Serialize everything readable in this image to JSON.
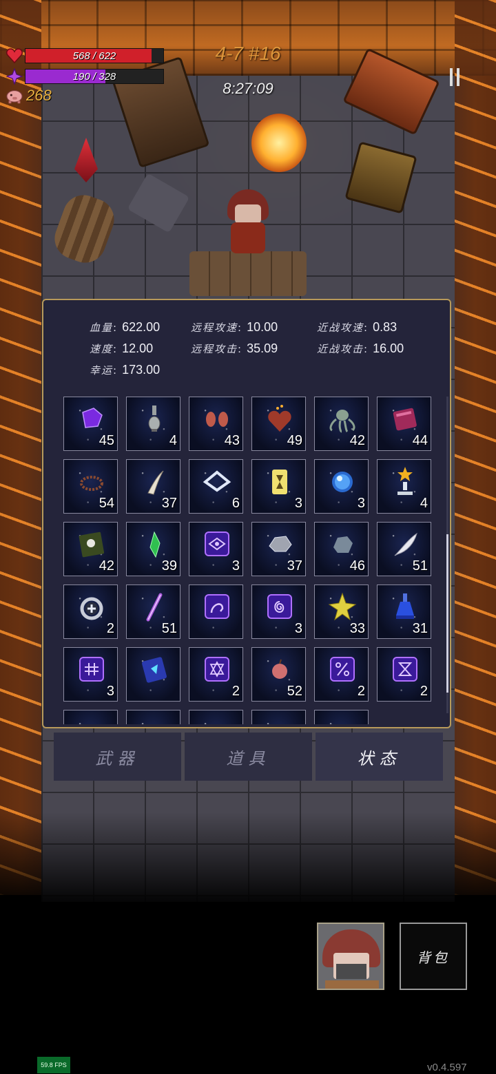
{
  "hud": {
    "hp_text": "568 / 622",
    "hp_fraction": 0.913,
    "mp_text": "190 / 328",
    "mp_fraction": 0.579,
    "gold": "268",
    "level": "4-7 #16",
    "timer": "8:27:09"
  },
  "colors": {
    "hp": "#d0202a",
    "mp": "#9a2ad0",
    "gold": "#e8b040",
    "panel_border": "#b89a5a"
  },
  "stats": {
    "hp": {
      "label": "血量",
      "value": "622.00"
    },
    "speed": {
      "label": "速度",
      "value": "12.00"
    },
    "luck": {
      "label": "幸运",
      "value": "173.00"
    },
    "ranged_speed": {
      "label": "远程攻速",
      "value": "10.00"
    },
    "ranged_attack": {
      "label": "远程攻击",
      "value": "35.09"
    },
    "melee_speed": {
      "label": "近战攻速",
      "value": "0.83"
    },
    "melee_attack": {
      "label": "近战攻击",
      "value": "16.00"
    }
  },
  "items": [
    {
      "icon": "purple-gem-icon",
      "count": "45"
    },
    {
      "icon": "potion-flask-icon",
      "count": "4"
    },
    {
      "icon": "glove-pair-icon",
      "count": "43"
    },
    {
      "icon": "fire-heart-icon",
      "count": "49"
    },
    {
      "icon": "tentacle-creature-icon",
      "count": "42"
    },
    {
      "icon": "red-book-icon",
      "count": "44"
    },
    {
      "icon": "thorn-wreath-icon",
      "count": "54"
    },
    {
      "icon": "fang-icon",
      "count": "37"
    },
    {
      "icon": "diamond-frame-icon",
      "count": "6"
    },
    {
      "icon": "hourglass-card-icon",
      "count": "3"
    },
    {
      "icon": "blue-orb-icon",
      "count": "3"
    },
    {
      "icon": "star-trophy-icon",
      "count": "4"
    },
    {
      "icon": "skull-book-icon",
      "count": "42"
    },
    {
      "icon": "green-crystal-icon",
      "count": "39"
    },
    {
      "icon": "rune-eye-icon",
      "count": "3"
    },
    {
      "icon": "grey-rock-icon",
      "count": "37"
    },
    {
      "icon": "blue-stone-icon",
      "count": "46"
    },
    {
      "icon": "feather-icon",
      "count": "51"
    },
    {
      "icon": "cross-ring-icon",
      "count": "2"
    },
    {
      "icon": "wand-icon",
      "count": "51"
    },
    {
      "icon": "rune-arc-icon",
      "count": ""
    },
    {
      "icon": "rune-spiral-icon",
      "count": "3"
    },
    {
      "icon": "gold-star-shard-icon",
      "count": "33"
    },
    {
      "icon": "blue-potion-icon",
      "count": "31"
    },
    {
      "icon": "rune-grid-icon",
      "count": "3"
    },
    {
      "icon": "blue-tome-icon",
      "count": ""
    },
    {
      "icon": "rune-triangle-icon",
      "count": "2"
    },
    {
      "icon": "apple-icon",
      "count": "52"
    },
    {
      "icon": "rune-percent-icon",
      "count": "2"
    },
    {
      "icon": "rune-hourglass-icon",
      "count": "2"
    }
  ],
  "tabs": [
    {
      "label": "武器",
      "active": false
    },
    {
      "label": "道具",
      "active": false
    },
    {
      "label": "状态",
      "active": true
    }
  ],
  "bag_label": "背包",
  "fps": "59.8 FPS",
  "version": "v0.4.597"
}
